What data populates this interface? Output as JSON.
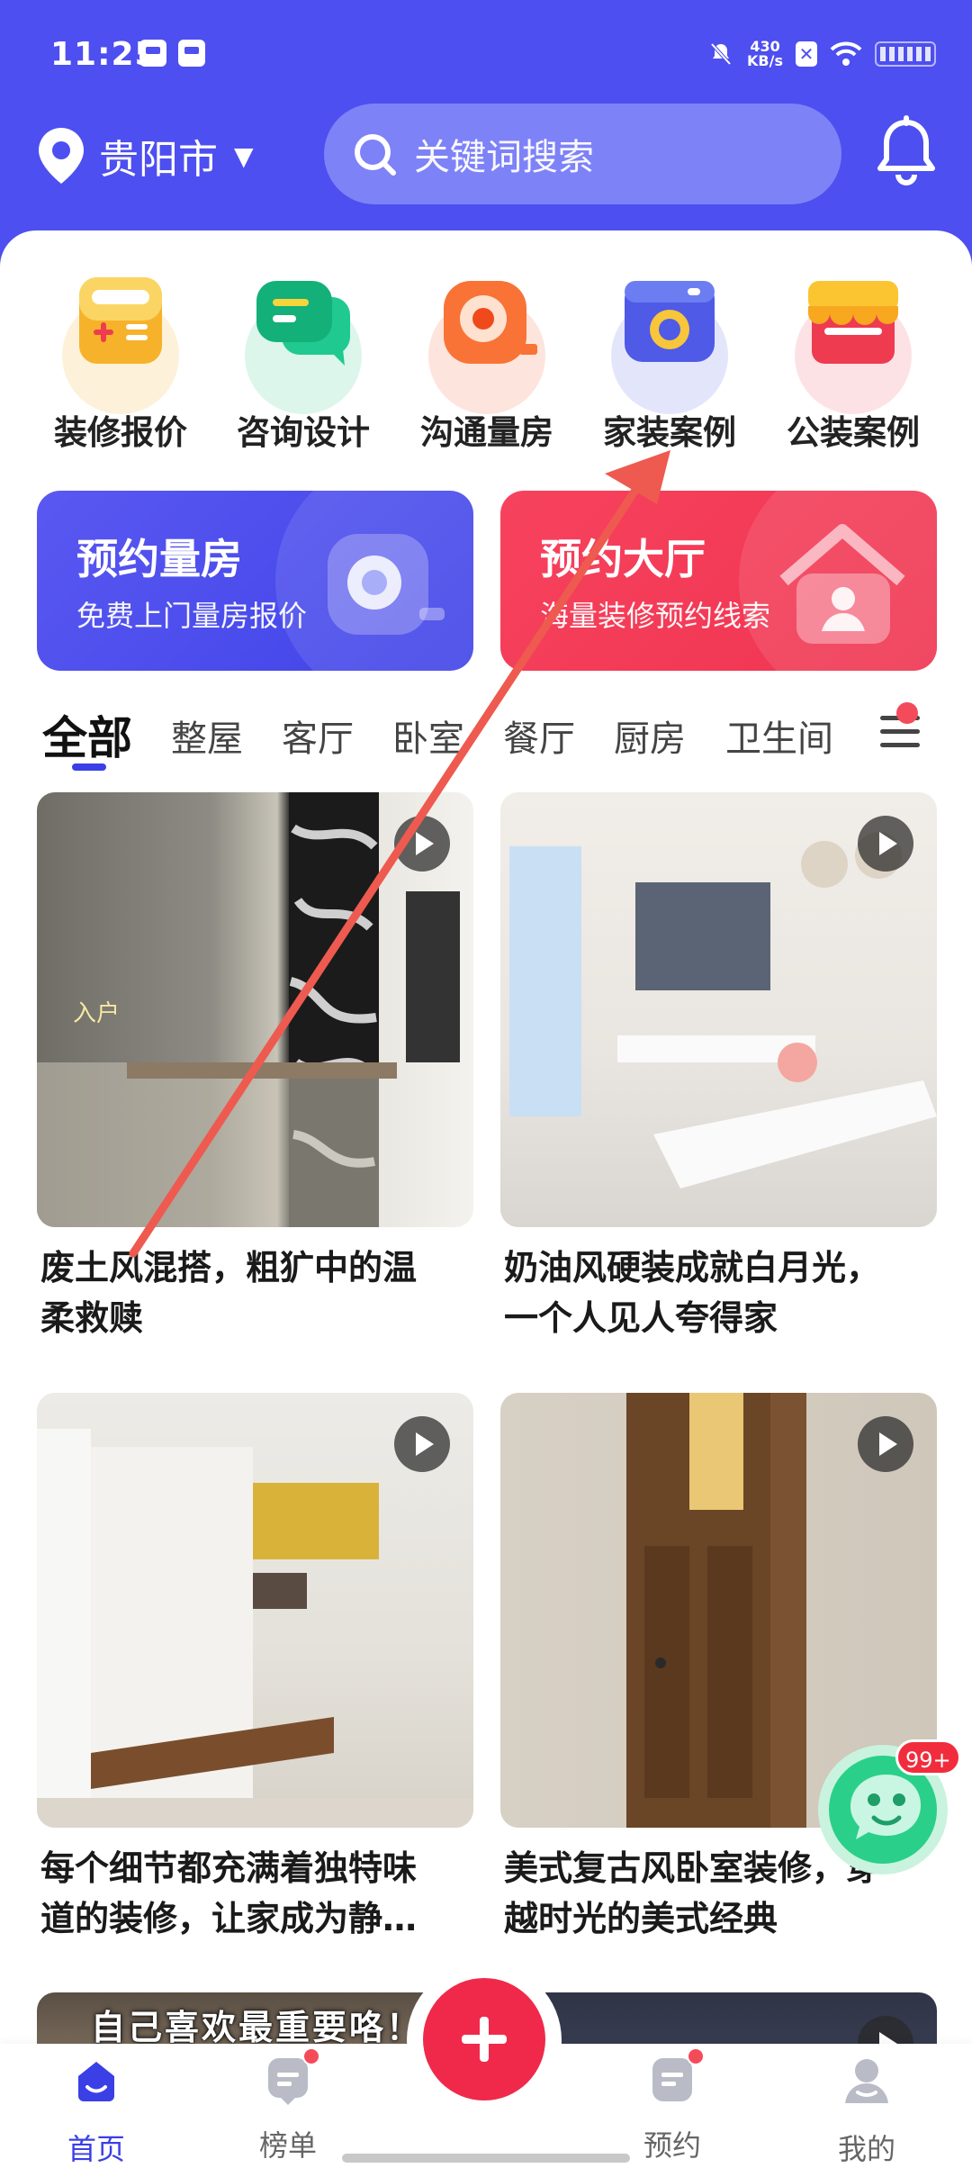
{
  "status_bar": {
    "time": "11:25",
    "net_speed_value": "430",
    "net_speed_unit": "KB/s"
  },
  "header": {
    "city": "贵阳市",
    "search_placeholder": "关键词搜索",
    "brand_color": "#4d4ff0"
  },
  "quick_actions": [
    {
      "label": "装修报价",
      "icon": "calculator-icon"
    },
    {
      "label": "咨询设计",
      "icon": "chat-bubbles-icon"
    },
    {
      "label": "沟通量房",
      "icon": "tape-measure-icon"
    },
    {
      "label": "家装案例",
      "icon": "camera-icon"
    },
    {
      "label": "公装案例",
      "icon": "storefront-icon"
    }
  ],
  "banners": [
    {
      "title": "预约量房",
      "subtitle": "免费上门量房报价",
      "color": "#4a4cee"
    },
    {
      "title": "预约大厅",
      "subtitle": "海量装修预约线索",
      "color": "#f33b56"
    }
  ],
  "tabs": [
    "全部",
    "整屋",
    "客厅",
    "卧室",
    "餐厅",
    "厨房",
    "卫生间"
  ],
  "cards": [
    {
      "title_line1": "废土风混搭，粗犷中的温",
      "title_line2": "柔救赎",
      "overlay_text": "入户"
    },
    {
      "title_line1": "奶油风硬装成就白月光，",
      "title_line2": "一个人见人夸得家"
    },
    {
      "title_line1": "每个细节都充满着独特味",
      "title_line2": "道的装修，让家成为静…"
    },
    {
      "title_line1": "美式复古风卧室装修，穿",
      "title_line2": "越时光的美式经典"
    }
  ],
  "peek_card_text": "自己喜欢最重要咯！",
  "chat_badge": "99+",
  "bottom_nav": [
    {
      "label": "首页",
      "icon": "home-icon",
      "active": true
    },
    {
      "label": "榜单",
      "icon": "ranking-icon",
      "active": false
    },
    {
      "label": "预约",
      "icon": "appointment-icon",
      "active": false
    },
    {
      "label": "我的",
      "icon": "profile-icon",
      "active": false
    }
  ],
  "annotation_color": "#ee5a4f"
}
